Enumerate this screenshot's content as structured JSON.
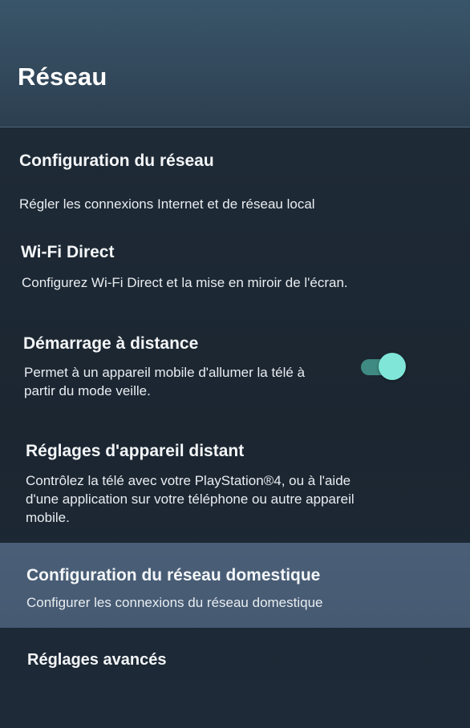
{
  "header": {
    "title": "Réseau"
  },
  "items": [
    {
      "title": "Configuration du réseau",
      "description": "Régler les connexions Internet et de réseau local"
    },
    {
      "title": "Wi-Fi Direct",
      "description": "Configurez Wi-Fi Direct et la mise en miroir de l'écran."
    },
    {
      "title": "Démarrage à distance",
      "description_line1": "Permet à un appareil mobile d'allumer la télé à",
      "description_line2": "partir du mode veille.",
      "toggle": {
        "state": "on",
        "icon": "toggle-switch"
      }
    },
    {
      "title": "Réglages d'appareil distant",
      "description_line1": "Contrôlez la télé avec votre PlayStation®4, ou à l'aide",
      "description_line2": "d'une application sur votre téléphone ou autre appareil",
      "description_line3": "mobile."
    },
    {
      "title": "Configuration du réseau domestique",
      "description": "Configurer les connexions du réseau domestique",
      "selected": true
    },
    {
      "title": "Réglages avancés"
    }
  ],
  "colors": {
    "header_bg": "#33495c",
    "content_bg": "#1c2733",
    "selected_bg": "#4a5f77",
    "toggle_track": "#3f8a82",
    "toggle_thumb": "#7fe6d8"
  }
}
